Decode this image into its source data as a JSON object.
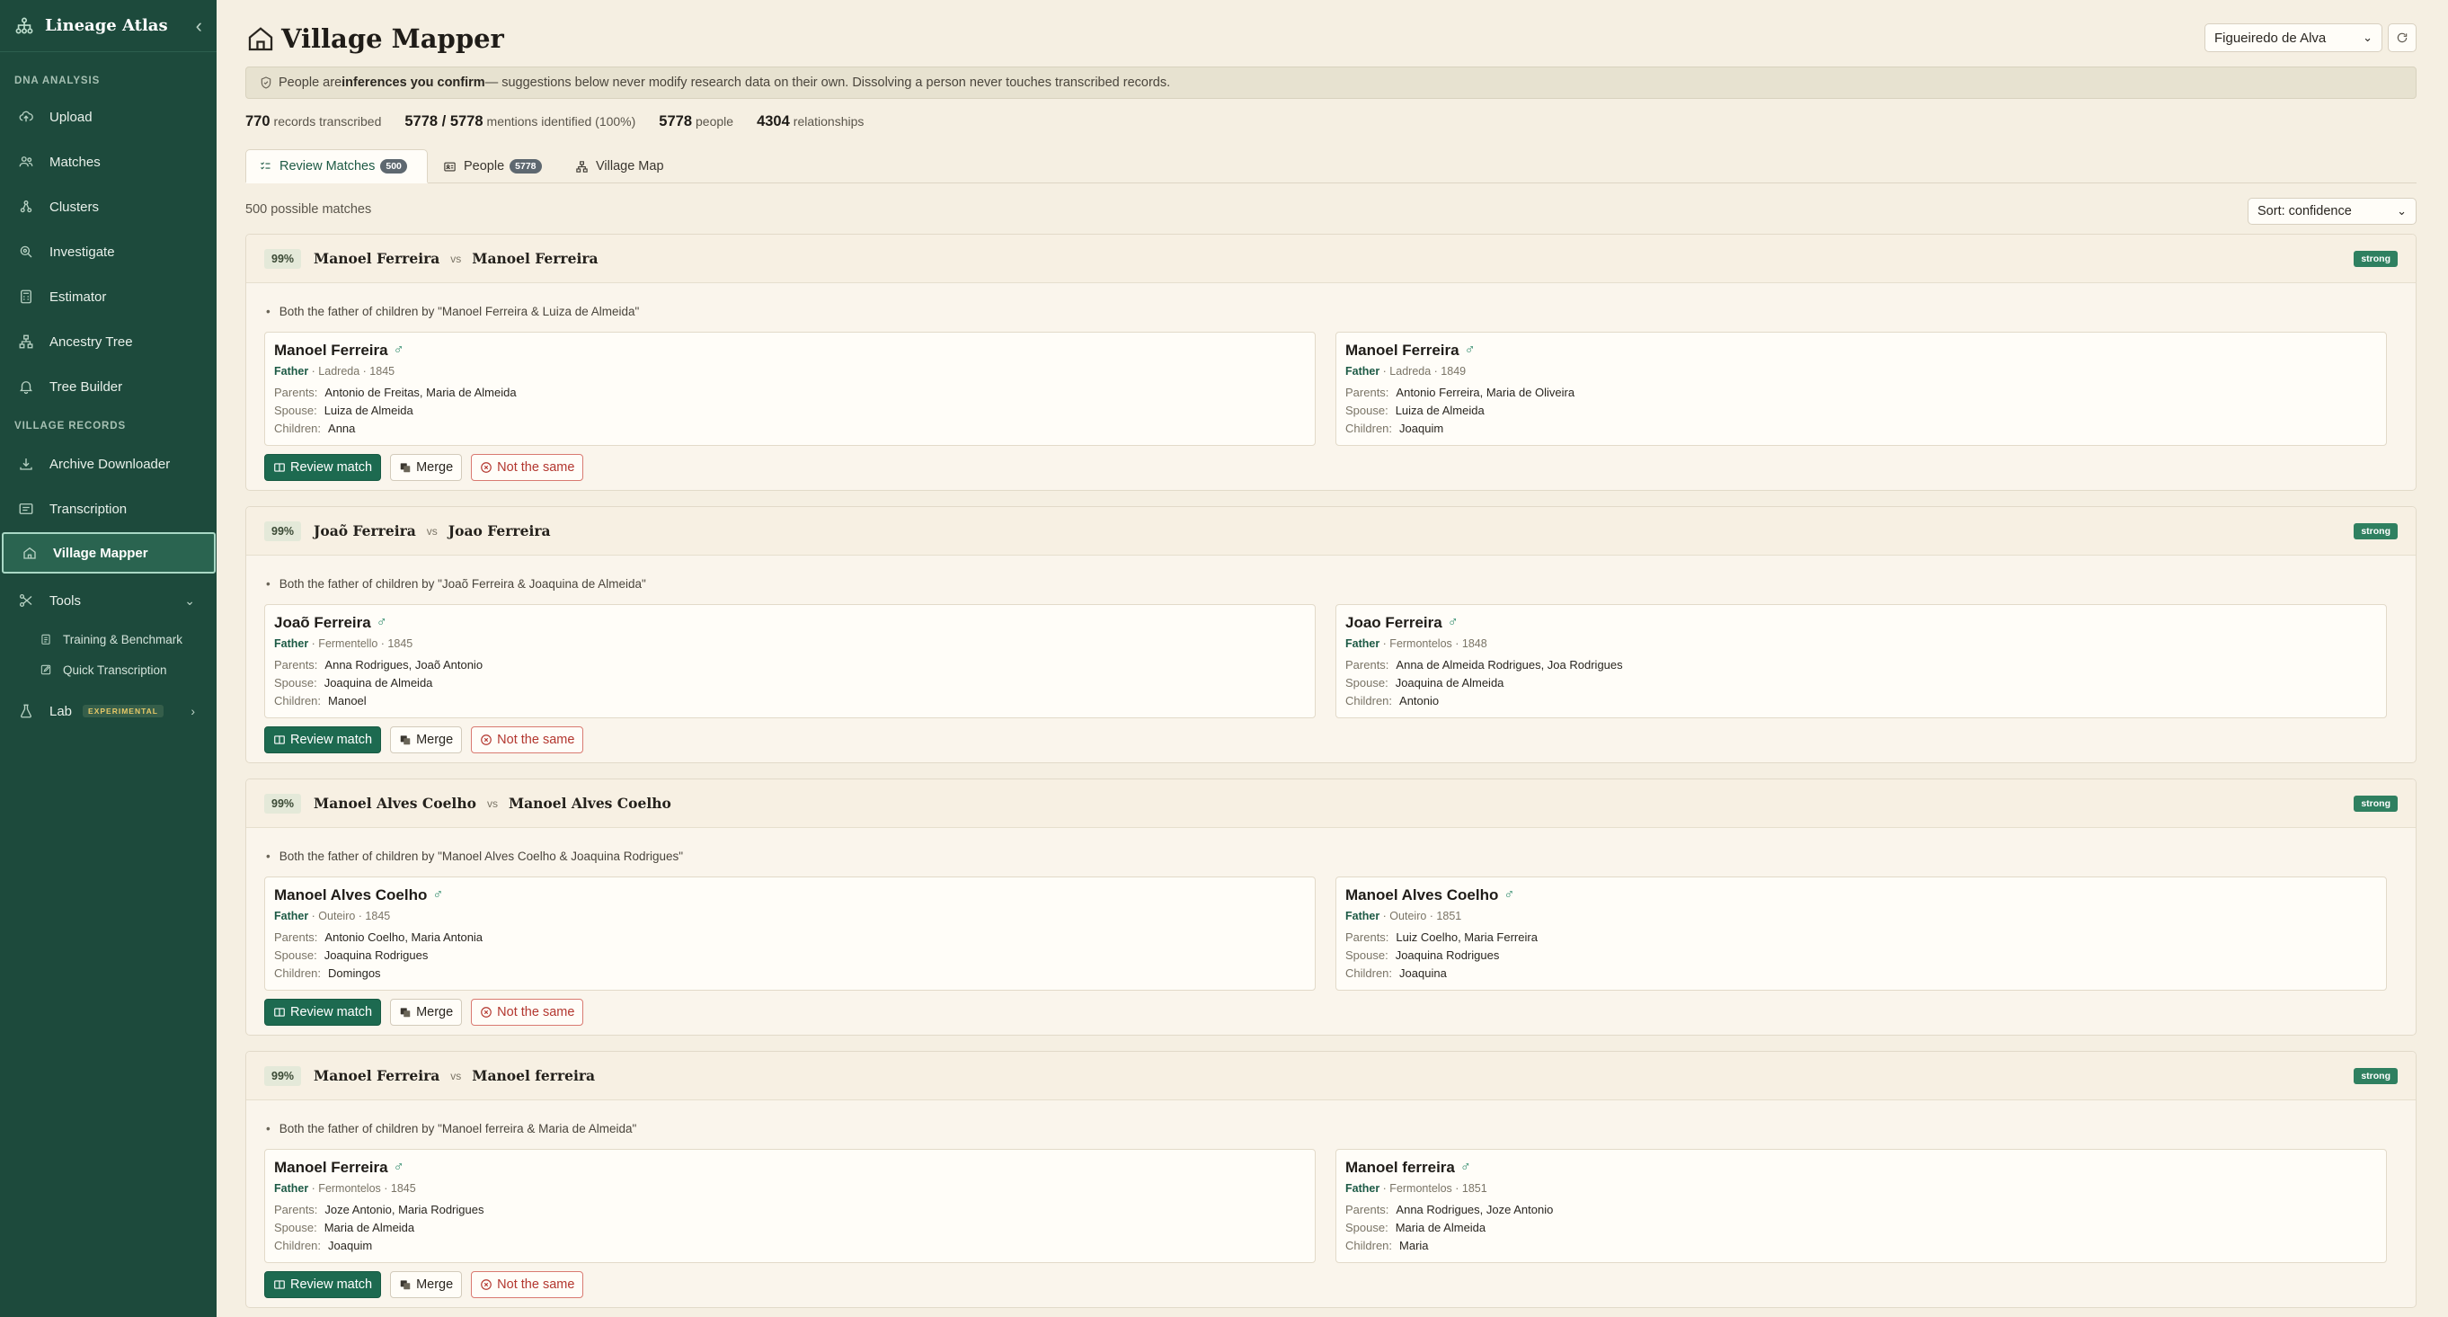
{
  "sidebar": {
    "brand": "Lineage Atlas",
    "collapse_icon": "chevron-left-icon",
    "sections": {
      "dna": "DNA ANALYSIS",
      "village": "VILLAGE RECORDS"
    },
    "dna_items": [
      "Upload",
      "Matches",
      "Clusters",
      "Investigate",
      "Estimator",
      "Ancestry Tree",
      "Tree Builder"
    ],
    "village_items": [
      "Archive Downloader",
      "Transcription",
      "Village Mapper"
    ],
    "active_item": "Village Mapper",
    "tools": {
      "label": "Tools",
      "children": [
        "Training & Benchmark",
        "Quick Transcription"
      ]
    },
    "lab": {
      "label": "Lab",
      "badge": "EXPERIMENTAL"
    }
  },
  "header": {
    "title": "Village Mapper",
    "village_select": "Figueiredo de Alva"
  },
  "notice": {
    "prefix": "People are ",
    "bold": "inferences you confirm",
    "suffix": " — suggestions below never modify research data on their own. Dissolving a person never touches transcribed records."
  },
  "stats": [
    {
      "value": "770",
      "label": "records transcribed"
    },
    {
      "value": "5778 / 5778",
      "label": "mentions identified (100%)"
    },
    {
      "value": "5778",
      "label": "people"
    },
    {
      "value": "4304",
      "label": "relationships"
    }
  ],
  "tabs": [
    {
      "label": "Review Matches",
      "count": "500",
      "active": true
    },
    {
      "label": "People",
      "count": "5778",
      "active": false
    },
    {
      "label": "Village Map",
      "count": "",
      "active": false
    }
  ],
  "list": {
    "count_text": "500 possible matches",
    "sort_label": "Sort: confidence"
  },
  "labels": {
    "vs": "vs",
    "parents": "Parents:",
    "spouse": "Spouse:",
    "children": "Children:",
    "review": "Review match",
    "merge": "Merge",
    "not_same": "Not the same",
    "male_symbol": "♂"
  },
  "matches": [
    {
      "confidence": "99%",
      "strength": "strong",
      "left_name": "Manoel Ferreira",
      "right_name": "Manoel Ferreira",
      "reason": "Both the father of children by \"Manoel Ferreira & Luiza de Almeida\"",
      "left": {
        "name": "Manoel Ferreira",
        "role": "Father",
        "meta": " · Ladreda · 1845",
        "parents": "Antonio de Freitas, Maria de Almeida",
        "spouse": "Luiza de Almeida",
        "children": "Anna"
      },
      "right": {
        "name": "Manoel Ferreira",
        "role": "Father",
        "meta": " · Ladreda · 1849",
        "parents": "Antonio Ferreira, Maria de Oliveira",
        "spouse": "Luiza de Almeida",
        "children": "Joaquim"
      }
    },
    {
      "confidence": "99%",
      "strength": "strong",
      "left_name": "Joaõ Ferreira",
      "right_name": "Joao Ferreira",
      "reason": "Both the father of children by \"Joaõ Ferreira & Joaquina de Almeida\"",
      "left": {
        "name": "Joaõ Ferreira",
        "role": "Father",
        "meta": " · Fermentello · 1845",
        "parents": "Anna Rodrigues, Joaõ Antonio",
        "spouse": "Joaquina de Almeida",
        "children": "Manoel"
      },
      "right": {
        "name": "Joao Ferreira",
        "role": "Father",
        "meta": " · Fermontelos · 1848",
        "parents": "Anna de Almeida Rodrigues, Joa Rodrigues",
        "spouse": "Joaquina de Almeida",
        "children": "Antonio"
      }
    },
    {
      "confidence": "99%",
      "strength": "strong",
      "left_name": "Manoel Alves Coelho",
      "right_name": "Manoel Alves Coelho",
      "reason": "Both the father of children by \"Manoel Alves Coelho & Joaquina Rodrigues\"",
      "left": {
        "name": "Manoel Alves Coelho",
        "role": "Father",
        "meta": " · Outeiro · 1845",
        "parents": "Antonio Coelho, Maria Antonia",
        "spouse": "Joaquina Rodrigues",
        "children": "Domingos"
      },
      "right": {
        "name": "Manoel Alves Coelho",
        "role": "Father",
        "meta": " · Outeiro · 1851",
        "parents": "Luiz Coelho, Maria Ferreira",
        "spouse": "Joaquina Rodrigues",
        "children": "Joaquina"
      }
    },
    {
      "confidence": "99%",
      "strength": "strong",
      "left_name": "Manoel Ferreira",
      "right_name": "Manoel ferreira",
      "reason": "Both the father of children by \"Manoel ferreira & Maria de Almeida\"",
      "left": {
        "name": "Manoel Ferreira",
        "role": "Father",
        "meta": " · Fermontelos · 1845",
        "parents": "Joze Antonio, Maria Rodrigues",
        "spouse": "Maria de Almeida",
        "children": "Joaquim"
      },
      "right": {
        "name": "Manoel ferreira",
        "role": "Father",
        "meta": " · Fermontelos · 1851",
        "parents": "Anna Rodrigues, Joze Antonio",
        "spouse": "Maria de Almeida",
        "children": "Maria"
      }
    }
  ],
  "colors": {
    "sidebar_bg": "#1d4a3c",
    "accent": "#1d6a50",
    "strong_badge": "#2f8060",
    "danger": "#b3372f",
    "page_bg": "#f5efe2"
  }
}
